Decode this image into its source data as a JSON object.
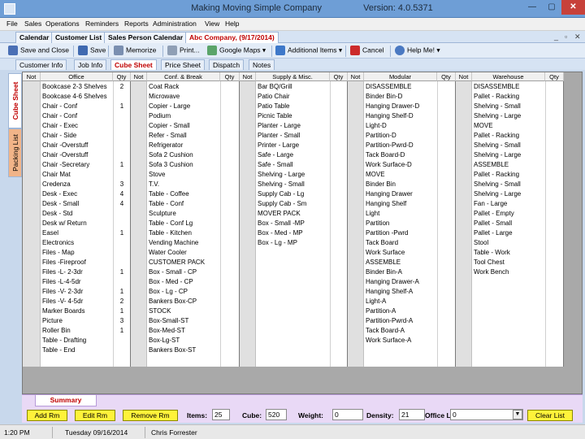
{
  "window": {
    "company": "Making Moving Simple Company",
    "version": "Version: 4.0.5371",
    "minimize": "—",
    "maximize": "▢",
    "close": "✕"
  },
  "menu": [
    "File",
    "Sales",
    "Operations",
    "Reminders",
    "Reports",
    "Administration",
    "View",
    "Help"
  ],
  "doc_tabs": [
    "Calendar",
    "Customer List",
    "Sales Person Calendar",
    "Abc Company, (9/17/2014)"
  ],
  "mdi": {
    "minimize": "_",
    "restore": "▫",
    "close": "✕"
  },
  "toolbar": {
    "save_close": "Save and Close",
    "save": "Save",
    "memorize": "Memorize",
    "print": "Print...",
    "google_maps": "Google Maps",
    "additional_items": "Additional Items",
    "cancel": "Cancel",
    "help": "Help Me!"
  },
  "sub_tabs": [
    "Customer Info",
    "Job Info",
    "Cube Sheet",
    "Price Sheet",
    "Dispatch",
    "Notes"
  ],
  "vertical_tabs": [
    "Cube Sheet",
    "Packing List"
  ],
  "columns": {
    "not": "Not",
    "qty": "Qty",
    "office": "Office",
    "conf": "Conf. & Break",
    "supply": "Supply & Misc.",
    "modular": "Modular",
    "warehouse": "Warehouse"
  },
  "office_items": [
    {
      "name": "Bookcase 2-3 Shelves",
      "qty": "2"
    },
    {
      "name": "Bookcase 4-6 Shelves",
      "qty": ""
    },
    {
      "name": "Chair - Conf",
      "qty": "1"
    },
    {
      "name": "Chair - Conf",
      "qty": ""
    },
    {
      "name": "Chair - Exec",
      "qty": ""
    },
    {
      "name": "Chair - Side",
      "qty": ""
    },
    {
      "name": "Chair -Overstuff",
      "qty": ""
    },
    {
      "name": "Chair -Overstuff",
      "qty": ""
    },
    {
      "name": "Chair -Secretary",
      "qty": "1"
    },
    {
      "name": "Chair Mat",
      "qty": ""
    },
    {
      "name": "Credenza",
      "qty": "3"
    },
    {
      "name": "Desk - Exec",
      "qty": "4"
    },
    {
      "name": "Desk - Small",
      "qty": "4"
    },
    {
      "name": "Desk - Std",
      "qty": ""
    },
    {
      "name": "Desk w/ Return",
      "qty": ""
    },
    {
      "name": "Easel",
      "qty": "1"
    },
    {
      "name": "Electronics",
      "qty": ""
    },
    {
      "name": "Files - Map",
      "qty": ""
    },
    {
      "name": "Files -Fireproof",
      "qty": ""
    },
    {
      "name": "Files -L- 2-3dr",
      "qty": "1"
    },
    {
      "name": "Files -L-4-5dr",
      "qty": ""
    },
    {
      "name": "Files -V- 2-3dr",
      "qty": "1"
    },
    {
      "name": "Files -V- 4-5dr",
      "qty": "2"
    },
    {
      "name": "Marker Boards",
      "qty": "1"
    },
    {
      "name": "Picture",
      "qty": "3"
    },
    {
      "name": "Roller Bin",
      "qty": "1"
    },
    {
      "name": "Table - Drafting",
      "qty": ""
    },
    {
      "name": "Table - End",
      "qty": ""
    }
  ],
  "conf_items": [
    {
      "name": "Coat Rack",
      "qty": ""
    },
    {
      "name": "Microwave",
      "qty": ""
    },
    {
      "name": "Copier - Large",
      "qty": ""
    },
    {
      "name": "Podium",
      "qty": ""
    },
    {
      "name": "Copier - Small",
      "qty": ""
    },
    {
      "name": "Refer - Small",
      "qty": ""
    },
    {
      "name": "Refrigerator",
      "qty": ""
    },
    {
      "name": "Sofa 2 Cushion",
      "qty": ""
    },
    {
      "name": "Sofa 3 Cushion",
      "qty": ""
    },
    {
      "name": "Stove",
      "qty": ""
    },
    {
      "name": "T.V.",
      "qty": ""
    },
    {
      "name": "Table - Coffee",
      "qty": ""
    },
    {
      "name": "Table - Conf",
      "qty": ""
    },
    {
      "name": "Sculpture",
      "qty": ""
    },
    {
      "name": "Table - Conf Lg",
      "qty": ""
    },
    {
      "name": "Table - Kitchen",
      "qty": ""
    },
    {
      "name": "Vending Machine",
      "qty": ""
    },
    {
      "name": "Water Cooler",
      "qty": ""
    },
    {
      "name": "CUSTOMER PACK",
      "qty": ""
    },
    {
      "name": "Box - Small - CP",
      "qty": ""
    },
    {
      "name": "Box - Med - CP",
      "qty": ""
    },
    {
      "name": "Box - Lg - CP",
      "qty": ""
    },
    {
      "name": "Bankers Box-CP",
      "qty": ""
    },
    {
      "name": "STOCK",
      "qty": ""
    },
    {
      "name": "Box-Small-ST",
      "qty": ""
    },
    {
      "name": "Box-Med-ST",
      "qty": ""
    },
    {
      "name": "Box-Lg-ST",
      "qty": ""
    },
    {
      "name": "Bankers Box-ST",
      "qty": ""
    }
  ],
  "supply_items": [
    {
      "name": "Bar BQ/Grill",
      "qty": ""
    },
    {
      "name": "Patio Chair",
      "qty": ""
    },
    {
      "name": "Patio Table",
      "qty": ""
    },
    {
      "name": "Picnic Table",
      "qty": ""
    },
    {
      "name": "Planter - Large",
      "qty": ""
    },
    {
      "name": "Planter - Small",
      "qty": ""
    },
    {
      "name": "Printer - Large",
      "qty": ""
    },
    {
      "name": "Safe - Large",
      "qty": ""
    },
    {
      "name": "Safe - Small",
      "qty": ""
    },
    {
      "name": "Shelving - Large",
      "qty": ""
    },
    {
      "name": "Shelving - Small",
      "qty": ""
    },
    {
      "name": "Supply Cab - Lg",
      "qty": ""
    },
    {
      "name": "Supply Cab - Sm",
      "qty": ""
    },
    {
      "name": "MOVER PACK",
      "qty": ""
    },
    {
      "name": "Box - Small -MP",
      "qty": ""
    },
    {
      "name": "Box - Med - MP",
      "qty": ""
    },
    {
      "name": "Box - Lg - MP",
      "qty": ""
    }
  ],
  "modular_items": [
    {
      "name": "DISASSEMBLE",
      "qty": ""
    },
    {
      "name": "Binder Bin-D",
      "qty": ""
    },
    {
      "name": "Hanging Drawer-D",
      "qty": ""
    },
    {
      "name": "Hanging Shelf-D",
      "qty": ""
    },
    {
      "name": "Light-D",
      "qty": ""
    },
    {
      "name": "Partition-D",
      "qty": ""
    },
    {
      "name": "Partition-Pwrd-D",
      "qty": ""
    },
    {
      "name": "Tack Board-D",
      "qty": ""
    },
    {
      "name": "Work Surface-D",
      "qty": ""
    },
    {
      "name": "MOVE",
      "qty": ""
    },
    {
      "name": "Binder Bin",
      "qty": ""
    },
    {
      "name": "Hanging Drawer",
      "qty": ""
    },
    {
      "name": "Hanging Shelf",
      "qty": ""
    },
    {
      "name": "Light",
      "qty": ""
    },
    {
      "name": "Partition",
      "qty": ""
    },
    {
      "name": "Partition -Pwrd",
      "qty": ""
    },
    {
      "name": "Tack Board",
      "qty": ""
    },
    {
      "name": "Work Surface",
      "qty": ""
    },
    {
      "name": "ASSEMBLE",
      "qty": ""
    },
    {
      "name": "Binder Bin-A",
      "qty": ""
    },
    {
      "name": "Hanging Drawer-A",
      "qty": ""
    },
    {
      "name": "Hanging Shelf-A",
      "qty": ""
    },
    {
      "name": "Light-A",
      "qty": ""
    },
    {
      "name": "Partition-A",
      "qty": ""
    },
    {
      "name": "Partition-Pwrd-A",
      "qty": ""
    },
    {
      "name": "Tack Board-A",
      "qty": ""
    },
    {
      "name": "Work Surface-A",
      "qty": ""
    }
  ],
  "warehouse_items": [
    {
      "name": "DISASSEMBLE",
      "qty": ""
    },
    {
      "name": "Pallet - Racking",
      "qty": ""
    },
    {
      "name": "Shelving - Small",
      "qty": ""
    },
    {
      "name": "Shelving - Large",
      "qty": ""
    },
    {
      "name": "MOVE",
      "qty": ""
    },
    {
      "name": "Pallet - Racking",
      "qty": ""
    },
    {
      "name": "Shelving - Small",
      "qty": ""
    },
    {
      "name": "Shelving - Large",
      "qty": ""
    },
    {
      "name": "ASSEMBLE",
      "qty": ""
    },
    {
      "name": "Pallet - Racking",
      "qty": ""
    },
    {
      "name": "Shelving - Small",
      "qty": ""
    },
    {
      "name": "Shelving - Large",
      "qty": ""
    },
    {
      "name": "Fan - Large",
      "qty": ""
    },
    {
      "name": "Pallet - Empty",
      "qty": ""
    },
    {
      "name": "Pallet - Small",
      "qty": ""
    },
    {
      "name": "Pallet - Large",
      "qty": ""
    },
    {
      "name": "Stool",
      "qty": ""
    },
    {
      "name": "Table - Work",
      "qty": ""
    },
    {
      "name": "Tool Chest",
      "qty": ""
    },
    {
      "name": "Work Bench",
      "qty": ""
    }
  ],
  "summary_tab": "Summary",
  "bottom": {
    "add_rm": "Add Rm",
    "edit_rm": "Edit Rm",
    "remove_rm": "Remove Rm",
    "items_label": "Items:",
    "items_value": "25",
    "cube_label": "Cube:",
    "cube_value": "520",
    "weight_label": "Weight:",
    "weight_value": "0",
    "density_label": "Density:",
    "density_value": "21",
    "office_label": "Office L",
    "office_value": "0",
    "clear_list": "Clear List"
  },
  "status": {
    "time": "1:20 PM",
    "date": "Tuesday 09/16/2014",
    "user": "Chris Forrester"
  },
  "colors": {
    "titlebar": "#6e9ed6",
    "active_tab_text": "#c00000",
    "yellow_button": "#fff23a",
    "summary_strip": "#e9d9f6"
  }
}
